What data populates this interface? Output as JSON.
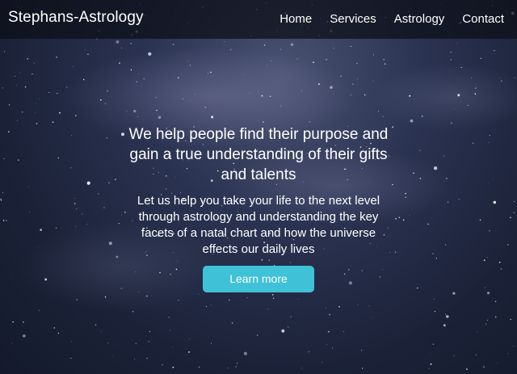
{
  "navbar": {
    "brand": "Stephans-Astrology",
    "links": [
      "Home",
      "Services",
      "Astrology",
      "Contact"
    ]
  },
  "hero": {
    "title": "We help people find their purpose and gain a true understanding of their gifts and talents",
    "subtitle": "Let us help you take your life to the next level through astrology and understanding the key facets of a natal chart and how the universe effects our daily lives",
    "cta_label": "Learn more"
  },
  "colors": {
    "navbar_bg": "#0c0e16",
    "accent": "#3fc2d8",
    "text": "#ffffff",
    "background": "#1b2238"
  }
}
